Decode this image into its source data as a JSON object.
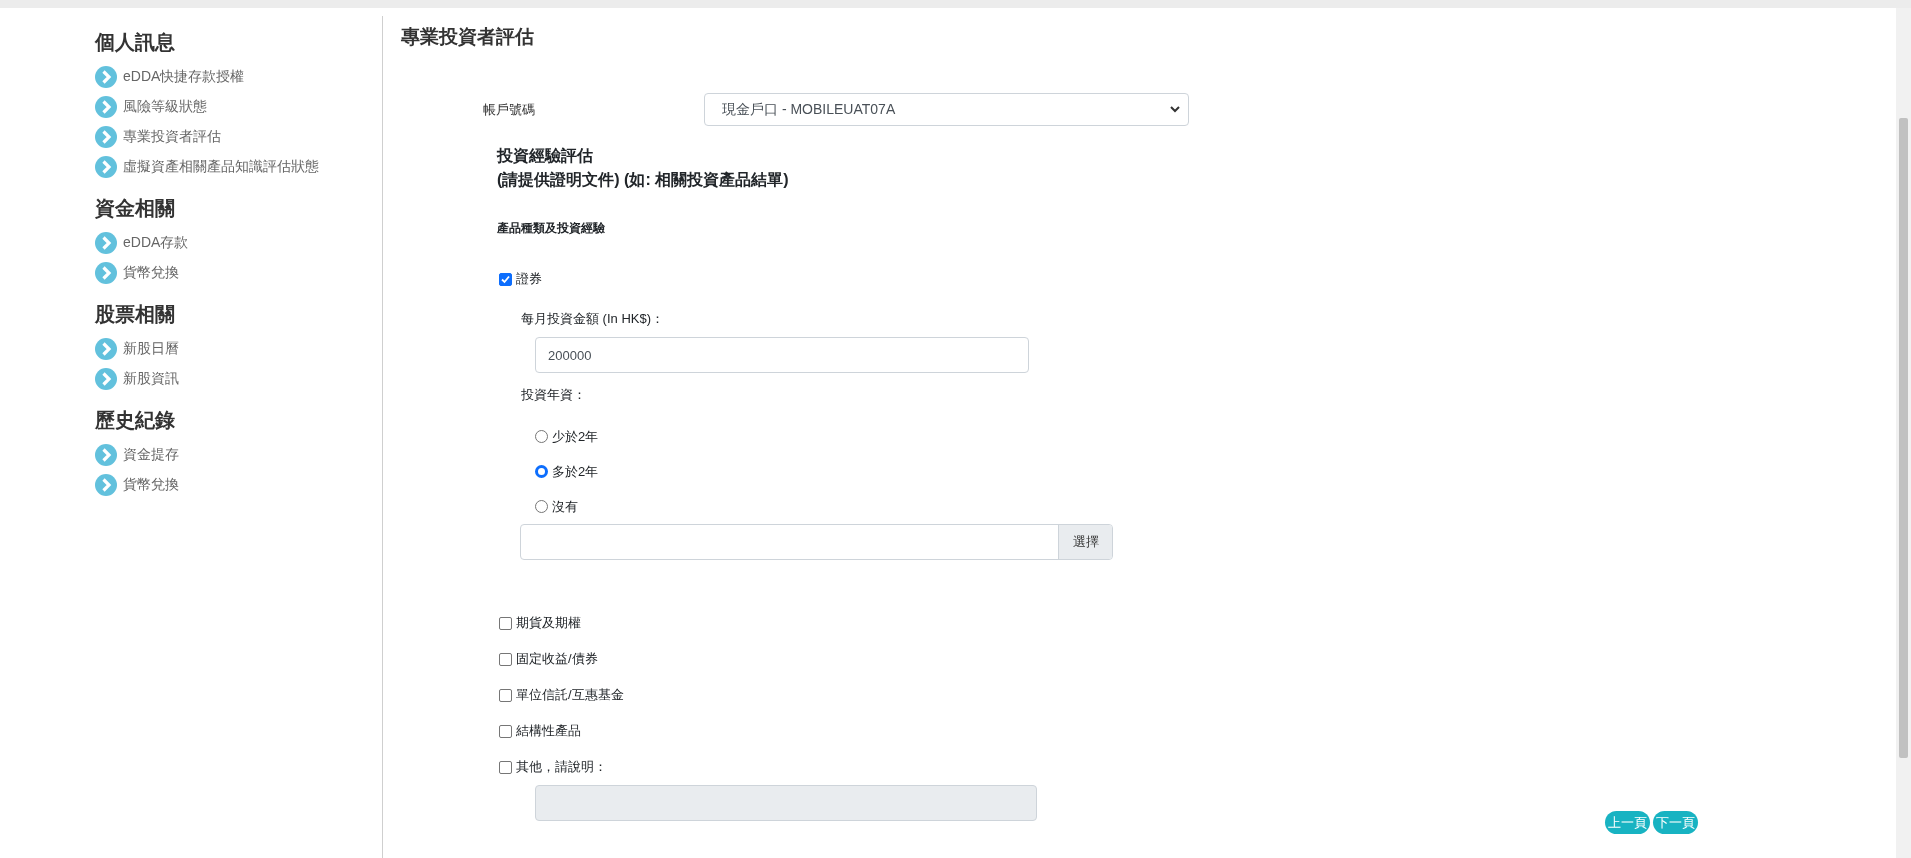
{
  "sidebar": {
    "sections": [
      {
        "title": "個人訊息",
        "items": [
          "eDDA快捷存款授權",
          "風險等級狀態",
          "專業投資者評估",
          "虛擬資產相關產品知識評估狀態"
        ]
      },
      {
        "title": "資金相關",
        "items": [
          "eDDA存款",
          "貨幣兌換"
        ]
      },
      {
        "title": "股票相關",
        "items": [
          "新股日曆",
          "新股資訊"
        ]
      },
      {
        "title": "歷史紀錄",
        "items": [
          "資金提存",
          "貨幣兌換"
        ]
      }
    ]
  },
  "page_title": "專業投資者評估",
  "account": {
    "label": "帳戶號碼",
    "value": "現金戶口 - MOBILEUAT07A"
  },
  "experience": {
    "title": "投資經驗評估",
    "subtitle": "(請提供證明文件) (如: 相關投資產品結單)",
    "heading": "產品種類及投資經驗",
    "products": [
      {
        "kind": "detailed",
        "label": "證券",
        "checked": true,
        "amount_label": "每月投資金額 (In HK$)：",
        "amount": "200000",
        "years_label": "投資年資：",
        "years": [
          {
            "label": "少於2年",
            "selected": false
          },
          {
            "label": "多於2年",
            "selected": true
          },
          {
            "label": "沒有",
            "selected": false
          }
        ],
        "file_button": "選擇"
      },
      {
        "kind": "plain",
        "label": "期貨及期權",
        "checked": false
      },
      {
        "kind": "plain",
        "label": "固定收益/債券",
        "checked": false
      },
      {
        "kind": "plain",
        "label": "單位信託/互惠基金",
        "checked": false
      },
      {
        "kind": "plain",
        "label": "結構性產品",
        "checked": false
      },
      {
        "kind": "other",
        "label": "其他，請說明：",
        "checked": false,
        "note_disabled": true
      }
    ]
  },
  "nav_buttons": [
    "上一頁",
    "下一頁"
  ]
}
